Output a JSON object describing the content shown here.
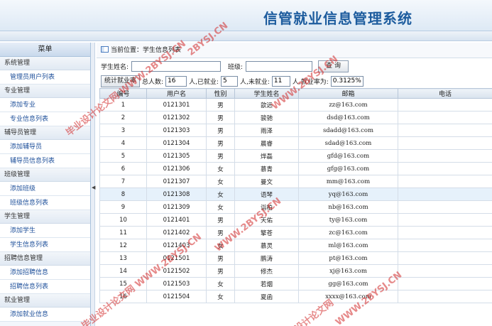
{
  "header": {
    "title": "信管就业信息管理系统"
  },
  "sidebar": {
    "menu_title": "菜单",
    "sections": [
      {
        "group": "系统管理",
        "items": [
          "管理员用户列表"
        ]
      },
      {
        "group": "专业管理",
        "items": [
          "添加专业",
          "专业信息列表"
        ]
      },
      {
        "group": "辅导员管理",
        "items": [
          "添加辅导员",
          "辅导员信息列表"
        ]
      },
      {
        "group": "班级管理",
        "items": [
          "添加班级",
          "班级信息列表"
        ]
      },
      {
        "group": "学生管理",
        "items": [
          "添加学生",
          "学生信息列表"
        ]
      },
      {
        "group": "招聘信息管理",
        "items": [
          "添加招聘信息",
          "招聘信息列表"
        ]
      },
      {
        "group": "就业管理",
        "items": [
          "添加就业信息"
        ]
      }
    ]
  },
  "breadcrumb": {
    "text": "当前位置：学生信息列表"
  },
  "search": {
    "name_label": "学生姓名:",
    "name_value": "",
    "class_label": "班级:",
    "class_value": "",
    "button_label": "查 询"
  },
  "stats": {
    "button_label": "统计就业率",
    "total_label": "总人数:",
    "total_value": "16",
    "employed_label": "人,已就业:",
    "employed_value": "5",
    "unemployed_label": "人,未就业:",
    "unemployed_value": "11",
    "rate_label": "人,就业率为:",
    "rate_value": "0.3125%"
  },
  "table": {
    "columns": [
      "编号",
      "用户名",
      "性别",
      "学生姓名",
      "邮箱",
      "电话"
    ],
    "rows": [
      [
        "1",
        "0121301",
        "男",
        "歆远",
        "zz@163.com",
        ""
      ],
      [
        "2",
        "0121302",
        "男",
        "骏驰",
        "dsd@163.com",
        ""
      ],
      [
        "3",
        "0121303",
        "男",
        "雨泽",
        "sdadd@163.com",
        ""
      ],
      [
        "4",
        "0121304",
        "男",
        "晨睿",
        "sdad@163.com",
        ""
      ],
      [
        "5",
        "0121305",
        "男",
        "烨磊",
        "gfd@163.com",
        ""
      ],
      [
        "6",
        "0121306",
        "女",
        "慕青",
        "gfg@163.com",
        ""
      ],
      [
        "7",
        "0121307",
        "女",
        "曼文",
        "mm@163.com",
        ""
      ],
      [
        "8",
        "0121308",
        "女",
        "语琴",
        "yq@163.com",
        ""
      ],
      [
        "9",
        "0121309",
        "女",
        "诣柏",
        "nb@163.com",
        ""
      ],
      [
        "10",
        "0121401",
        "男",
        "天佑",
        "ty@163.com",
        ""
      ],
      [
        "11",
        "0121402",
        "男",
        "擎苍",
        "zc@163.com",
        ""
      ],
      [
        "12",
        "0121403",
        "女",
        "慕灵",
        "ml@163.com",
        ""
      ],
      [
        "13",
        "0121501",
        "男",
        "鹏涛",
        "pt@163.com",
        ""
      ],
      [
        "14",
        "0121502",
        "男",
        "修杰",
        "xj@163.com",
        ""
      ],
      [
        "15",
        "0121503",
        "女",
        "若烟",
        "gg@163.com",
        ""
      ],
      [
        "16",
        "0121504",
        "女",
        "夏函",
        "xxxx@163.com",
        ""
      ]
    ],
    "highlighted_row": 8
  },
  "watermarks": [
    "2BYSJ.CN",
    "毕业设计论文网 WWW.2BYSJ.CN",
    "WWW.2BYSJ.CN",
    "WWW.2BYSJ.CN",
    "毕业设计论文网 WWW.2BYSJ.CN",
    "WWW.2BYSJ.CN",
    "设计论文网"
  ]
}
